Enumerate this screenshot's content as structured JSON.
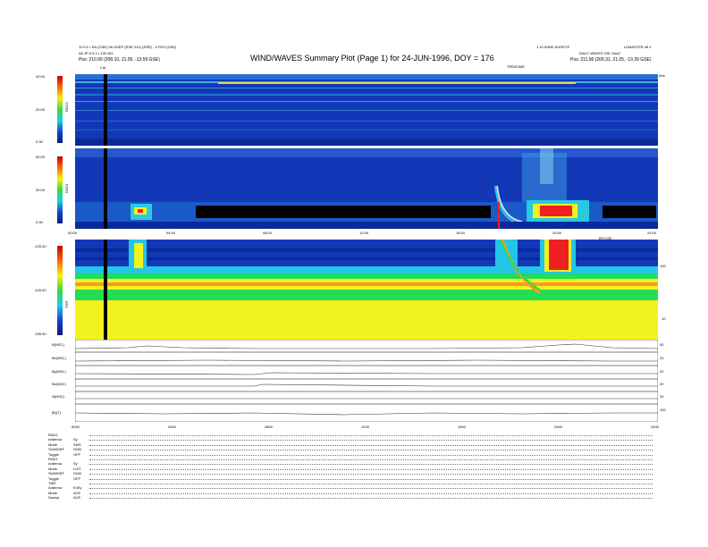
{
  "header": {
    "title": "WIND/WAVES Summary Plot (Page 1) for 24-JUN-1996, DOY = 176",
    "left_line1": "12:0:0 • RA (GSE) 96-GSEP (RSE 010) (RSE) - 4 FEO (GSE)",
    "left_line2": "A6 JP 6 9.3 • 135 081",
    "left_pos": "Pos: 210.90 (208.10, 21.05, -13.59 GSE)",
    "right_line1": "1.10 WIND SURFCE",
    "right_line2": "DAILY WAVES 200, DaxZ",
    "right_pos": "Pos: 211.96 (209.31, 21.05, -13.39 GSE)",
    "right_corner": "LEMASTER off 2",
    "cal_label": "Cal",
    "tr_label": "TREATIME",
    "top_right_tick": "kHz",
    "mid_tick_label": "BF/OSE"
  },
  "colors": {
    "bg_blue": "#1238b8",
    "deep_blue": "#0a2a9a",
    "cyan": "#22c6e6",
    "green": "#22dd55",
    "yellow": "#f2f21e",
    "red": "#ee2020",
    "black": "#000000"
  },
  "chart_data": [
    {
      "type": "heatmap",
      "name": "rad2",
      "ylabel": "RAD2",
      "colorbar_ticks": [
        "40.00",
        "20.00",
        "0.00"
      ]
    },
    {
      "type": "heatmap",
      "name": "rad1",
      "ylabel": "RAD1",
      "colorbar_ticks": [
        "60.00",
        "30.00",
        "0.00"
      ],
      "x_ticks": [
        "00:00",
        "04:00",
        "08:00",
        "12:00",
        "16:00",
        "20:00",
        "24:00"
      ]
    },
    {
      "type": "heatmap",
      "name": "tnr",
      "ylabel": "TNR",
      "colorbar_ticks": [
        "-125.00",
        "-140.00",
        "-155.00"
      ],
      "right_ticks": [
        "100",
        "10"
      ]
    },
    {
      "type": "line",
      "name": "mfi",
      "traces": [
        {
          "label": "B(NSC)",
          "right": "50"
        },
        {
          "label": "Bx(NSC)",
          "right": "20"
        },
        {
          "label": "By(NSC)",
          "right": "20"
        },
        {
          "label": "Bz(NSC)",
          "right": "20"
        },
        {
          "label": "N(NSC)",
          "right": "20"
        },
        {
          "label": "|B|(T)",
          "right": "100"
        }
      ],
      "x_ticks": [
        "0000",
        "0400",
        "0800",
        "1200",
        "1600",
        "2000",
        "2400"
      ]
    }
  ],
  "status": [
    {
      "label": "RAD2",
      "value": ""
    },
    {
      "label": "Antenna",
      "value": "Sy"
    },
    {
      "label": "Mode",
      "value": "SMS"
    },
    {
      "label": "SUM/DEF",
      "value": "SUM"
    },
    {
      "label": "Toggle",
      "value": "OFF"
    },
    {
      "label": "RAD1",
      "value": ""
    },
    {
      "label": "Antenna",
      "value": "Sy"
    },
    {
      "label": "Mode",
      "value": "LIST"
    },
    {
      "label": "SUM/DEF",
      "value": "SUM"
    },
    {
      "label": "Toggle",
      "value": "OFF"
    },
    {
      "label": "TNR",
      "value": ""
    },
    {
      "label": "Antenna",
      "value": "ExEy"
    },
    {
      "label": "Mode",
      "value": "ACE"
    },
    {
      "label": "Sweep",
      "value": "ACE"
    }
  ]
}
